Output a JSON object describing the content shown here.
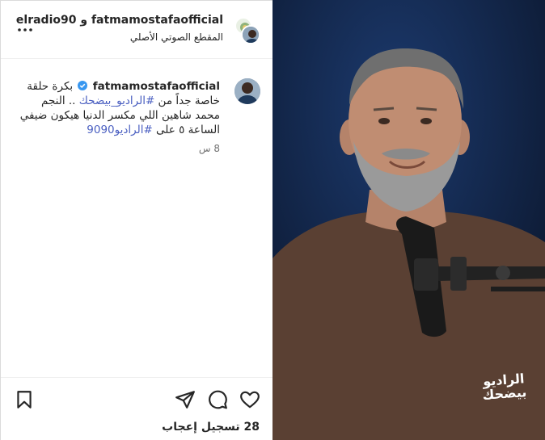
{
  "header": {
    "title": "fatmamostafaofficial و elradio90",
    "subtitle": "المقطع الصوتي الأصلي",
    "more_icon": "more-horizontal-icon"
  },
  "caption": {
    "username": "fatmamostafaofficial",
    "verified_icon": "verified-badge-icon",
    "text_part1": "بكرة حلقة خاصة جداً من ",
    "hashtag1": "#الراديو_بيضحك",
    "text_part2": " .. النجم محمد شاهين اللي مكسر الدنيا هيكون ضيفي الساعة ٥ على ",
    "hashtag2": "#الراديو9090",
    "time": "8 س"
  },
  "actions": {
    "like_icon": "heart-icon",
    "comment_icon": "comment-icon",
    "share_icon": "send-icon",
    "save_icon": "bookmark-icon"
  },
  "likes_text": "28 تسجيل إعجاب",
  "media": {
    "logo_text": "الراديو بيضحك",
    "background_color": "#0f1e3a",
    "shirt_color": "#5a4033"
  },
  "colors": {
    "hashtag": "#4a5fc1",
    "verified": "#3897f0"
  }
}
